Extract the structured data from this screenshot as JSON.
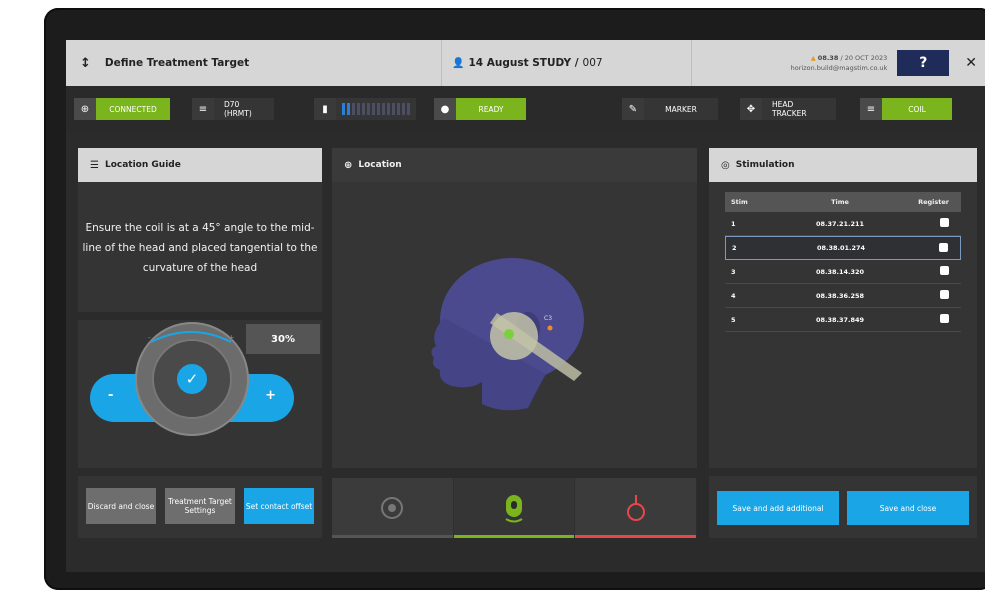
{
  "header": {
    "title": "Define Treatment Target",
    "study_name": "14 August STUDY /",
    "study_id": "007",
    "time": "08.38",
    "date": "/ 20 OCT 2023",
    "host": "horizon.build@magstim.co.uk",
    "help_label": "?",
    "close_label": "✕"
  },
  "status": {
    "connection": "CONNECTED",
    "coil_model": "D70 (HRMT)",
    "temperature_level": 0.15,
    "ready": "READY",
    "marker": "MARKER",
    "head_tracker": "HEAD TRACKER",
    "coil": "COIL"
  },
  "location_guide": {
    "title": "Location Guide",
    "instruction": "Ensure the coil is at a 45° angle to the mid-line of the head and placed tangential to the curvature of the head"
  },
  "intensity": {
    "value": "30%",
    "minus_label": "-",
    "plus_label": "+"
  },
  "buttons": {
    "discard": "Discard and close",
    "target_settings": "Treatment Target Settings",
    "contact_offset": "Set contact offset",
    "save_add": "Save and add additional",
    "save_close": "Save and close"
  },
  "location": {
    "title": "Location",
    "marker_label": "C3"
  },
  "stimulation": {
    "title": "Stimulation",
    "columns": [
      "Stim",
      "Time",
      "Register"
    ],
    "rows": [
      {
        "stim": "1",
        "time": "08.37.21.211"
      },
      {
        "stim": "2",
        "time": "08.38.01.274"
      },
      {
        "stim": "3",
        "time": "08.38.14.320"
      },
      {
        "stim": "4",
        "time": "08.38.36.258"
      },
      {
        "stim": "5",
        "time": "08.38.37.849"
      }
    ]
  },
  "colors": {
    "accent_green": "#7bb51d",
    "accent_blue": "#1aa6e6",
    "help_navy": "#1f2c5a",
    "mode_red": "#e84848"
  }
}
